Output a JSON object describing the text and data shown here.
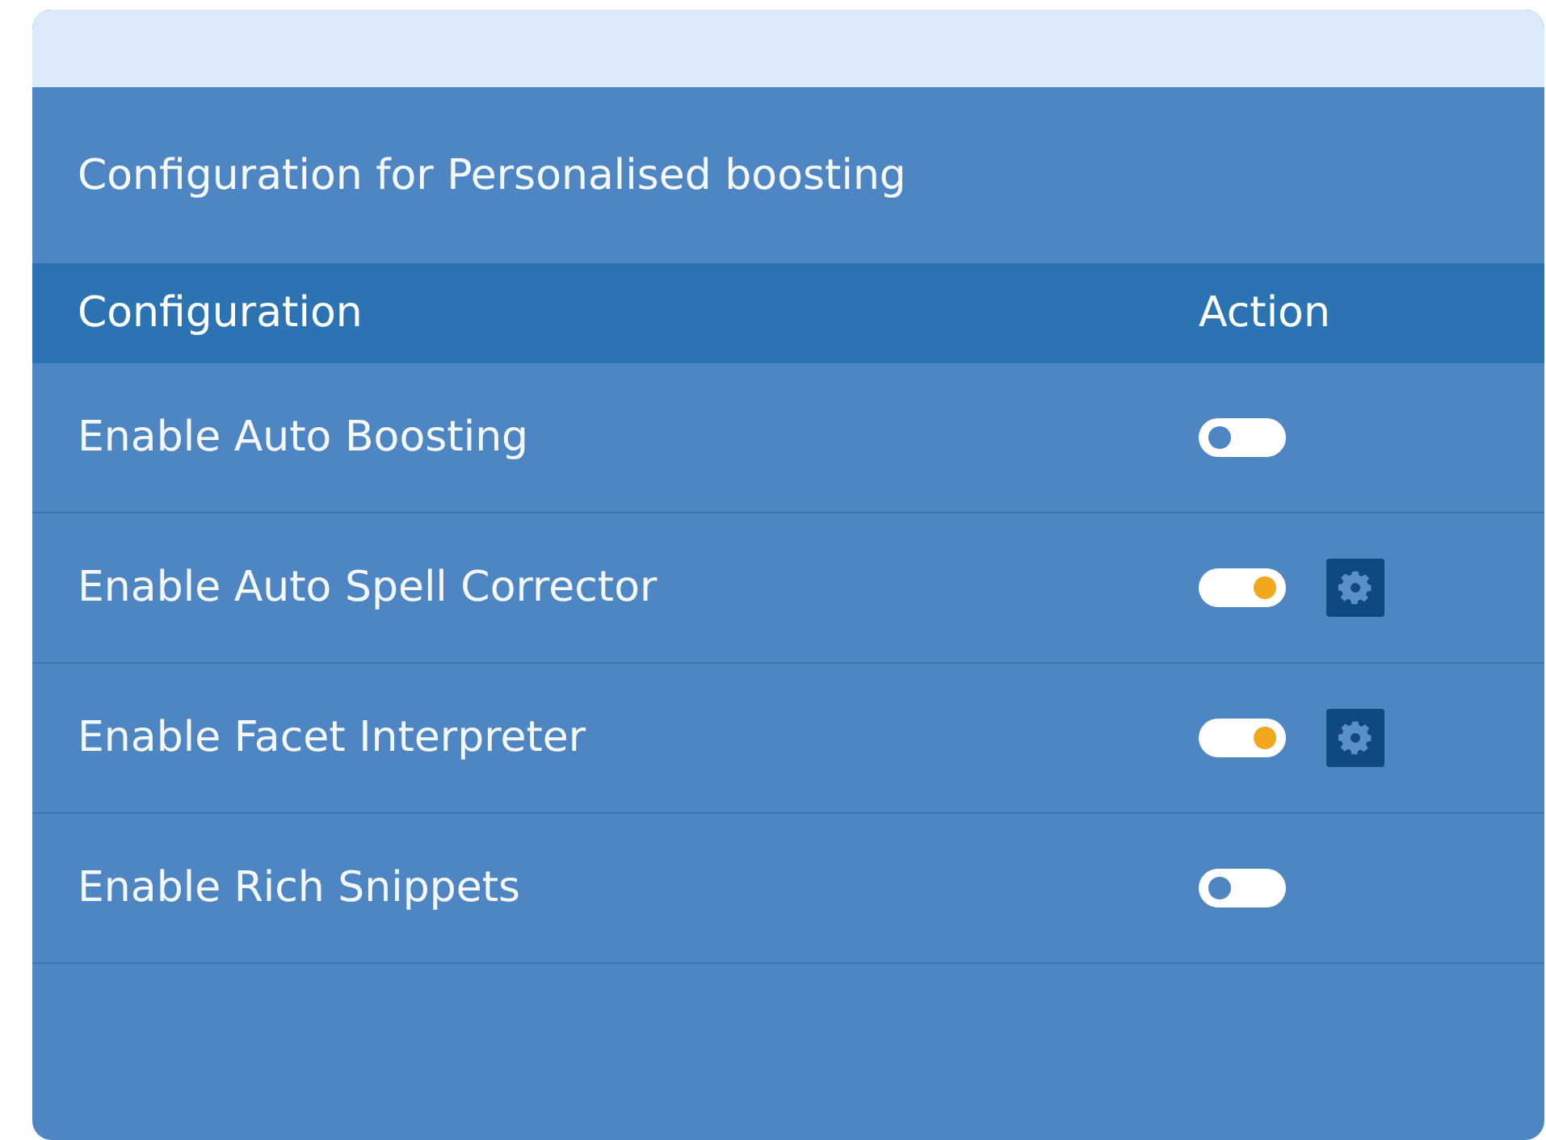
{
  "title": "Configuration for Personalised boosting",
  "columns": [
    "Configuration",
    "Action"
  ],
  "rows": [
    {
      "label": "Enable Auto Boosting",
      "on": false,
      "has_settings": false
    },
    {
      "label": "Enable Auto Spell Corrector",
      "on": true,
      "has_settings": true
    },
    {
      "label": "Enable Facet Interpreter",
      "on": true,
      "has_settings": true
    },
    {
      "label": "Enable Rich Snippets",
      "on": false,
      "has_settings": false
    }
  ]
}
